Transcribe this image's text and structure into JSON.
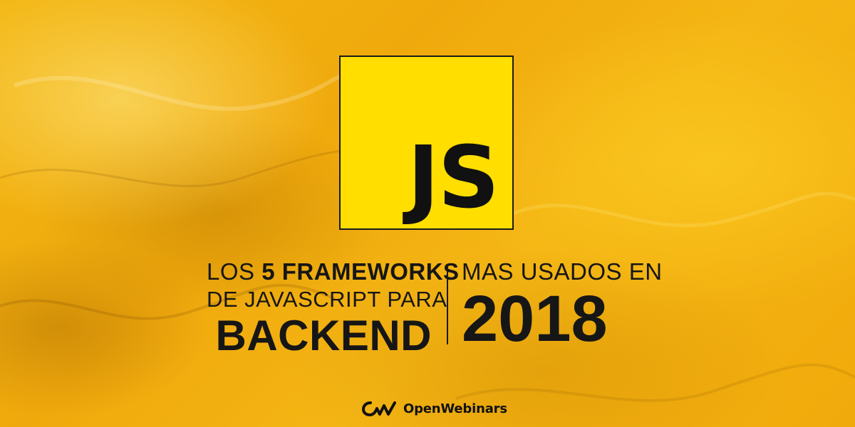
{
  "logo": {
    "text": "JS",
    "color": "#ffde00"
  },
  "headline": {
    "line1_prefix": "LOS ",
    "line1_emphasis": "5 FRAMEWORKS",
    "line2": "DE JAVASCRIPT PARA",
    "line3": "BACKEND",
    "line4": "MAS USADOS EN",
    "year": "2018"
  },
  "brand": {
    "name": "OpenWebinars",
    "icon": "openwebinars-logo-icon"
  },
  "colors": {
    "background": "#f3b713",
    "text": "#161616"
  }
}
